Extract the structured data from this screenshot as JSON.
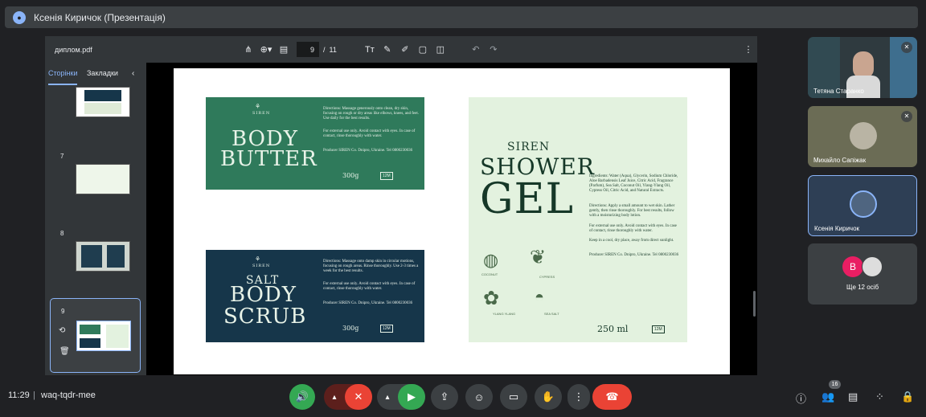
{
  "window": {
    "title": "Ксенія Киричок (Презентація)"
  },
  "pdf_viewer": {
    "filename": "диплом.pdf",
    "current_page": "9",
    "total_pages": "11",
    "tabs": [
      "Сторінки",
      "Закладки"
    ],
    "thumbnail_numbers": [
      "7",
      "8",
      "9"
    ]
  },
  "slide": {
    "body_butter": {
      "brand": "SIREN",
      "title_line1": "BODY",
      "title_line2": "BUTTER",
      "directions": "Directions: Massage generously onto clean, dry skin, focusing on rough or dry areas like elbows, knees, and feet. Use daily for the best results.",
      "warning": "For external use only. Avoid contact with eyes. In case of contact, rinse thoroughly with water.",
      "producer": "Producer SIREN Co. Dnipro, Ukraine. Tel 0800230036",
      "weight": "300g",
      "pao": "12M"
    },
    "body_scrub": {
      "brand": "SIREN",
      "title_line1": "SALT",
      "title_line2": "BODY",
      "title_line3": "SCRUB",
      "directions": "Directions: Massage onto damp skin in circular motions, focusing on rough areas. Rinse thoroughly. Use 2-3 times a week for the best results.",
      "warning": "For external use only. Avoid contact with eyes. In case of contact, rinse thoroughly with water.",
      "producer": "Producer SIREN Co. Dnipro, Ukraine. Tel 0800230036",
      "weight": "300g",
      "pao": "12M"
    },
    "shower_gel": {
      "brand": "SIREN",
      "title_line1": "SHOWER",
      "title_line2": "GEL",
      "ingredients": "Ingredients: Water (Aqua), Glycerin, Sodium Chloride, Aloe Barbadensis Leaf Juice, Citric Acid, Fragrance (Parfum), Sea Salt, Coconut Oil, Ylang-Ylang Oil, Cypress Oil, Citric Acid, and Natural Extracts.",
      "directions": "Directions: Apply a small amount to wet skin. Lather gently, then rinse thoroughly. For best results, follow with a moisturizing body lotion.",
      "warning": "For external use only. Avoid contact with eyes. In case of contact, rinse thoroughly with water.",
      "storage": "Keep in a cool, dry place, away from direct sunlight.",
      "producer": "Producer SIREN Co. Dnipro, Ukraine. Tel 0800230036",
      "volume": "250 ml",
      "pao": "12M",
      "illustrations": [
        "COCONUT",
        "CYPRESS",
        "YLANG YLANG",
        "SEA SALT"
      ]
    }
  },
  "participants": [
    {
      "name": "Тетяна Старанко",
      "muted": true
    },
    {
      "name": "Михайло Сапіжак",
      "muted": true
    },
    {
      "name": "Ксенія Киричок",
      "muted": false
    },
    {
      "name": "Ще 12 осіб",
      "muted": false,
      "avatar_letter": "B"
    }
  ],
  "bottom_bar": {
    "time": "11:29",
    "meeting_code": "waq-tqdr-mee",
    "participant_count": "16"
  },
  "colors": {
    "butter_green": "#2f7a5b",
    "scrub_navy": "#16364a",
    "gel_mint": "#e3f2df",
    "end_call": "#ea4335",
    "active_green": "#34a853",
    "accent_blue": "#8ab4f8"
  }
}
